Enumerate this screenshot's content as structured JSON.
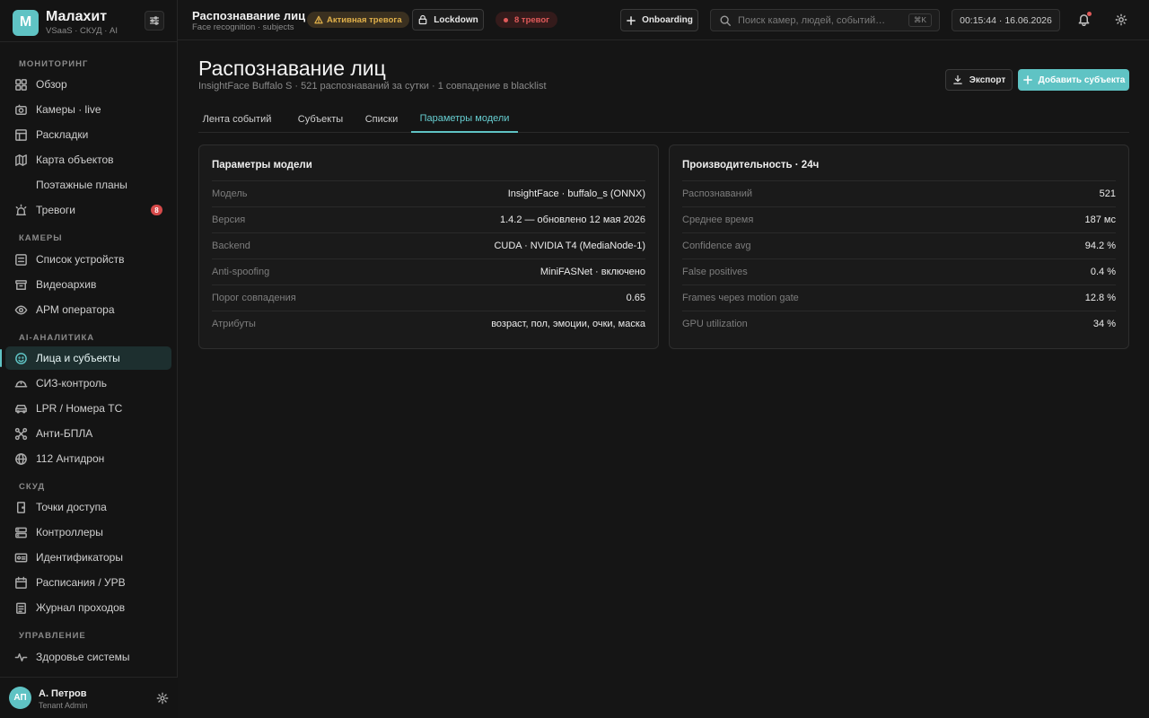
{
  "brand": {
    "logo_letter": "М",
    "name": "Малахит",
    "subtitle": "VSaaS · СКУД · AI"
  },
  "sidebar": {
    "sections": {
      "monitoring": "Мониторинг",
      "cameras": "Камеры",
      "ai": "AI-аналитика",
      "skud": "СКУД",
      "management": "Управление"
    },
    "items": {
      "overview": "Обзор",
      "cameras_live": "Камеры · live",
      "layouts": "Раскладки",
      "object_map": "Карта объектов",
      "floor_plans": "Поэтажные планы",
      "alarms": "Тревоги",
      "alarms_badge": "8",
      "devices": "Список устройств",
      "archive": "Видеоархив",
      "operator": "АРМ оператора",
      "faces": "Лица и субъекты",
      "ppe": "СИЗ-контроль",
      "lpr": "LPR / Номера ТС",
      "anti_uav": "Анти-БПЛА",
      "antidrone": "112 Антидрон",
      "access_points": "Точки доступа",
      "controllers": "Контроллеры",
      "identifiers": "Идентификаторы",
      "schedules": "Расписания / УРВ",
      "pass_log": "Журнал проходов",
      "health": "Здоровье системы"
    }
  },
  "user": {
    "initials": "АП",
    "name": "А. Петров",
    "role": "Tenant Admin"
  },
  "topbar": {
    "title": "Распознавание лиц",
    "subtitle": "Face recognition · subjects",
    "alert_label": "Активная тревога",
    "lockdown_label": "Lockdown",
    "alarms_label": "8 тревог",
    "onboarding_label": "Onboarding",
    "search_placeholder": "Поиск камер, людей, событий…",
    "search_shortcut": "⌘K",
    "datetime": "00:15:44 · 16.06.2026"
  },
  "page": {
    "title": "Распознавание лиц",
    "subtitle": "InsightFace Buffalo S · 521 распознаваний за сутки · 1 совпадение в blacklist",
    "export_label": "Экспорт",
    "add_label": "Добавить субъекта"
  },
  "tabs": [
    {
      "label": "Лента событий"
    },
    {
      "label": "Субъекты"
    },
    {
      "label": "Списки"
    },
    {
      "label": "Параметры модели"
    }
  ],
  "model_card": {
    "title": "Параметры модели",
    "rows": [
      {
        "label": "Модель",
        "value": "InsightFace · buffalo_s (ONNX)"
      },
      {
        "label": "Версия",
        "value": "1.4.2 — обновлено 12 мая 2026"
      },
      {
        "label": "Backend",
        "value": "CUDA · NVIDIA T4 (MediaNode-1)"
      },
      {
        "label": "Anti-spoofing",
        "value": "MiniFASNet · включено"
      },
      {
        "label": "Порог совпадения",
        "value": "0.65"
      },
      {
        "label": "Атрибуты",
        "value": "возраст, пол, эмоции, очки, маска"
      }
    ]
  },
  "perf_card": {
    "title": "Производительность · 24ч",
    "rows": [
      {
        "label": "Распознаваний",
        "value": "521"
      },
      {
        "label": "Среднее время",
        "value": "187 мс"
      },
      {
        "label": "Confidence avg",
        "value": "94.2 %"
      },
      {
        "label": "False positives",
        "value": "0.4 %"
      },
      {
        "label": "Frames через motion gate",
        "value": "12.8 %"
      },
      {
        "label": "GPU utilization",
        "value": "34 %"
      }
    ]
  },
  "colors": {
    "accent": "#5fc3c4",
    "danger": "#e05a5a",
    "warning": "#e0b04a",
    "background": "#151515"
  }
}
